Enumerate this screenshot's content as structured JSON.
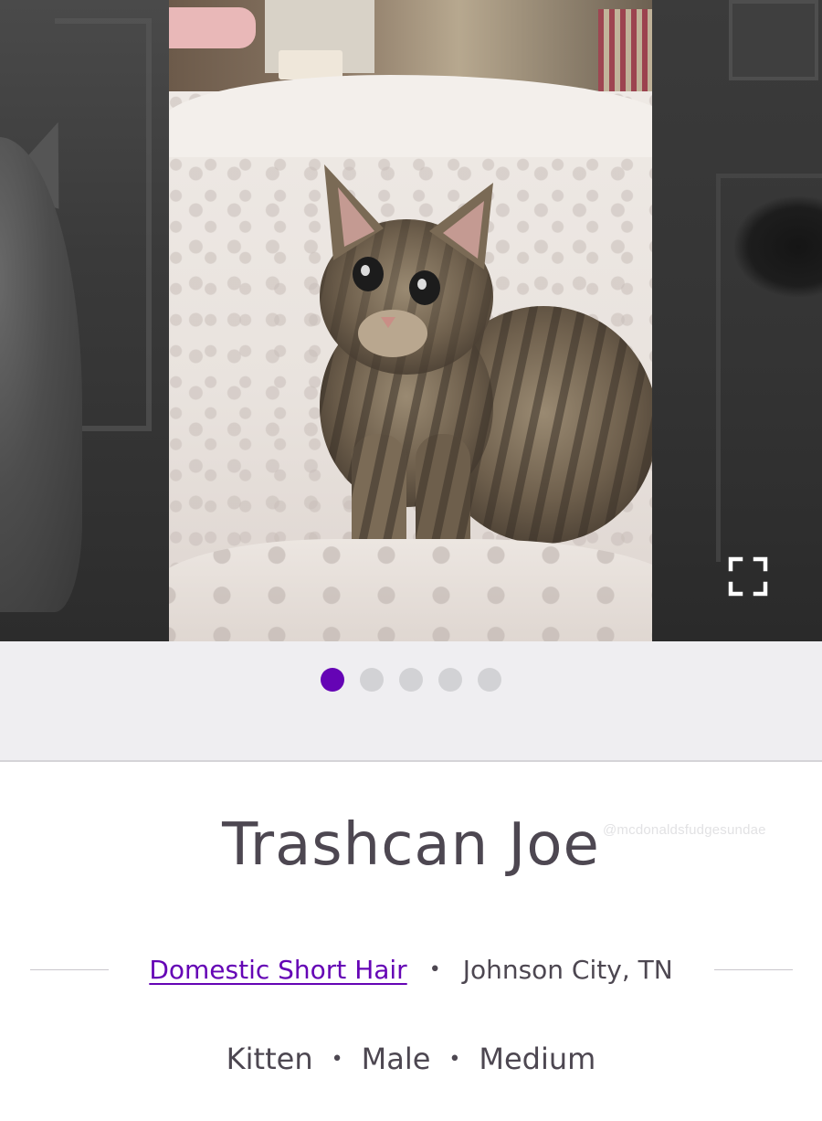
{
  "carousel": {
    "photo_count": 5,
    "active_index": 0,
    "accent_color": "#6504b5",
    "inactive_dot_color": "#d2d2d5",
    "expand_icon": "expand-fullscreen-icon"
  },
  "pet": {
    "name": "Trashcan Joe",
    "breed": "Domestic Short Hair",
    "location": "Johnson City, TN",
    "age": "Kitten",
    "sex": "Male",
    "size": "Medium",
    "separator": "•"
  },
  "watermark": "@mcdonaldsfudgesundae"
}
